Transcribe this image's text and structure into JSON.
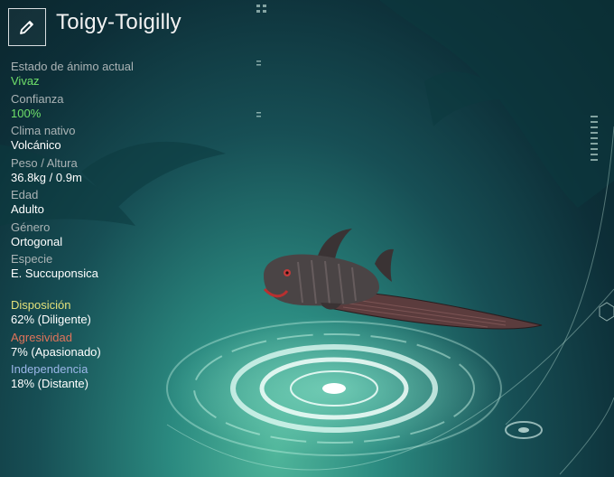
{
  "creature": {
    "name": "Toigy-Toigilly"
  },
  "icons": {
    "edit": "pencil-icon"
  },
  "stats": [
    {
      "label": "Estado de ánimo actual",
      "value": "Vivaz",
      "highlight": true
    },
    {
      "label": "Confianza",
      "value": "100%",
      "highlight": true
    },
    {
      "label": "Clima nativo",
      "value": "Volcánico",
      "highlight": false
    },
    {
      "label": "Peso / Altura",
      "value": "36.8kg / 0.9m",
      "highlight": false
    },
    {
      "label": "Edad",
      "value": "Adulto",
      "highlight": false
    },
    {
      "label": "Género",
      "value": "Ortogonal",
      "highlight": false
    },
    {
      "label": "Especie",
      "value": "E. Succuponsica",
      "highlight": false
    }
  ],
  "traits": [
    {
      "label": "Disposición",
      "value": "62% (Diligente)",
      "color": "#e2e07a"
    },
    {
      "label": "Agresividad",
      "value": "7% (Apasionado)",
      "color": "#e0735a"
    },
    {
      "label": "Independencia",
      "value": "18% (Distante)",
      "color": "#9bb6e8"
    }
  ],
  "colors": {
    "highlight": "#6fe06a",
    "label": "#aab3b5"
  }
}
